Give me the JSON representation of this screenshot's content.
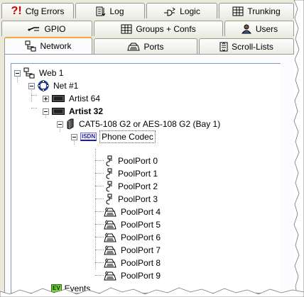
{
  "tabs": {
    "row1": [
      {
        "label": "Cfg Errors",
        "icon": "error-icon"
      },
      {
        "label": "Log",
        "icon": "log-icon"
      },
      {
        "label": "Logic",
        "icon": "logic-icon"
      },
      {
        "label": "Trunking",
        "icon": "trunking-icon"
      }
    ],
    "row2": [
      {
        "label": "GPIO",
        "icon": "gpio-icon"
      },
      {
        "label": "Groups + Confs",
        "icon": "groups-icon"
      },
      {
        "label": "Users",
        "icon": "users-icon"
      }
    ],
    "row3": [
      {
        "label": "Network",
        "icon": "network-icon",
        "active": true
      },
      {
        "label": "Ports",
        "icon": "ports-icon"
      },
      {
        "label": "Scroll-Lists",
        "icon": "scroll-lists-icon"
      }
    ]
  },
  "tree": {
    "web": "Web 1",
    "net": "Net #1",
    "artist64": "Artist 64",
    "artist32": "Artist 32",
    "card": "CAT5-108 G2 or AES-108 G2 (Bay  1)",
    "codec": "Phone Codec",
    "codec_badge": "ISDN",
    "ports": [
      "PoolPort 0",
      "PoolPort 1",
      "PoolPort 2",
      "PoolPort 3",
      "PoolPort 4",
      "PoolPort 5",
      "PoolPort 6",
      "PoolPort 7",
      "PoolPort 8",
      "PoolPort 9"
    ]
  },
  "events": {
    "label": "Events",
    "badge": "EV"
  },
  "colors": {
    "active_tab_accent": "#f1a93b",
    "selection": "#555555"
  }
}
